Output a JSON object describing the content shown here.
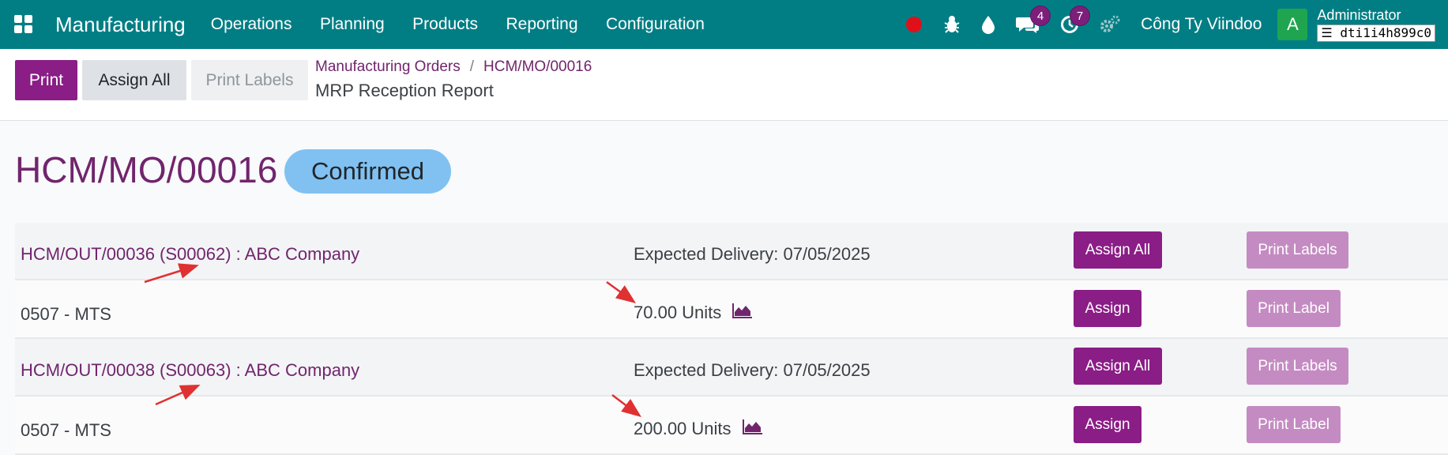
{
  "navbar": {
    "brand": "Manufacturing",
    "menu": [
      "Operations",
      "Planning",
      "Products",
      "Reporting",
      "Configuration"
    ],
    "messages_count": "4",
    "activities_count": "7",
    "company": "Công Ty Viindoo",
    "avatar_letter": "A",
    "user": "Administrator",
    "database": "dti1i4h899c0"
  },
  "control": {
    "print_label": "Print",
    "assign_all_label": "Assign All",
    "print_labels_label": "Print Labels",
    "breadcrumb": [
      "Manufacturing Orders",
      "HCM/MO/00016"
    ],
    "breadcrumb_sep": "/",
    "subtitle": "MRP Reception Report"
  },
  "order": {
    "name": "HCM/MO/00016",
    "state": "Confirmed"
  },
  "groups": [
    {
      "header": "HCM/OUT/00036 (S00062) : ABC Company",
      "expected": "Expected Delivery: 07/05/2025",
      "assign_all": "Assign All",
      "print_labels": "Print Labels",
      "line": {
        "product": "0507 - MTS",
        "qty": "70.00 Units",
        "assign": "Assign",
        "print_label": "Print Label"
      }
    },
    {
      "header": "HCM/OUT/00038 (S00063) : ABC Company",
      "expected": "Expected Delivery: 07/05/2025",
      "assign_all": "Assign All",
      "print_labels": "Print Labels",
      "line": {
        "product": "0507 - MTS",
        "qty": "200.00 Units",
        "assign": "Assign",
        "print_label": "Print Label"
      }
    }
  ],
  "colors": {
    "navbar": "#017e84",
    "primary": "#8a1d86",
    "link": "#71256d",
    "state_badge": "#80c1f2",
    "annotation_arrow": "#e03131"
  },
  "icons": [
    "apps-grid-icon",
    "record-icon",
    "bug-icon",
    "drop-icon",
    "chat-icon",
    "clock-icon",
    "settings-icon",
    "database-icon",
    "area-chart-icon"
  ]
}
